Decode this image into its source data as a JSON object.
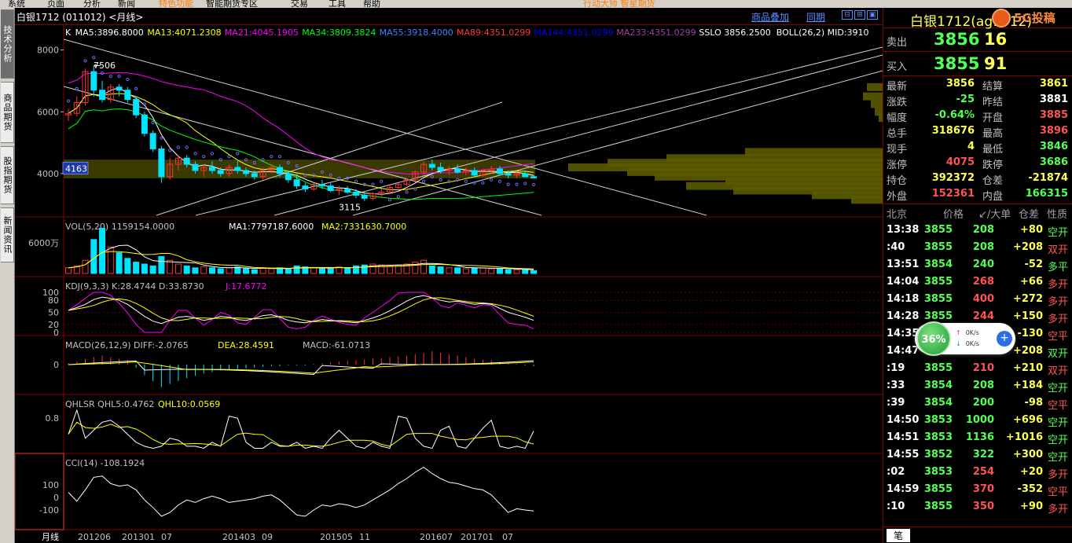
{
  "topbar": {
    "menu": [
      "系统",
      "页面",
      "分析",
      "新闻",
      "特色功能",
      "智能期货专区",
      "交易",
      "工具",
      "帮助"
    ],
    "center_text": "行动大师 智星期货"
  },
  "left_tabs": [
    {
      "label": "技术分析",
      "active": true
    },
    {
      "label": "商品期货",
      "active": false
    },
    {
      "label": "股指期货",
      "active": false
    },
    {
      "label": "新闻资讯",
      "active": false
    }
  ],
  "chart_header": {
    "title": "白银1712 (011012) <月线>",
    "btn_overlay": "商品叠加",
    "btn_sync": "同期"
  },
  "colors": {
    "up": "#ff3232",
    "down": "#00e5ff",
    "ma5": "#ffffff",
    "ma13": "#ffff00",
    "ma21": "#ff00ff",
    "ma34": "#00ff00",
    "ma55": "#3f7fff",
    "ma89": "#ff3838",
    "ma144": "#0000ff",
    "ma233": "#a040a0",
    "grid_red": "#800000"
  },
  "main_panel": {
    "legend": [
      {
        "text": "K",
        "color": "#ffffff"
      },
      {
        "text": "MA5:3896.8000",
        "color": "#ffffff"
      },
      {
        "text": "MA13:4071.2308",
        "color": "#ffff00"
      },
      {
        "text": "MA21:4045.1905",
        "color": "#ff00ff"
      },
      {
        "text": "MA34:3809.3824",
        "color": "#00ff00"
      },
      {
        "text": "MA55:3918.4000",
        "color": "#3f7fff"
      },
      {
        "text": "MA89:4351.0299",
        "color": "#ff3838"
      },
      {
        "text": "MA144:4351.0299",
        "color": "#0000ff"
      },
      {
        "text": "MA233:4351.0299",
        "color": "#a040a0"
      },
      {
        "text": "SSLO 3856.2500",
        "color": "#ffffff"
      },
      {
        "text": "BOLL(26,2) MID:3910",
        "color": "#ffffff"
      }
    ],
    "y_labels": [
      "8000",
      "6000",
      "4000"
    ],
    "price_tag": "4163",
    "high_label": "7506",
    "low_label": "3115"
  },
  "vol_panel": {
    "legend": "VOL(5,20) 1159154.0000",
    "ma1": "MA1:7797187.6000",
    "ma2": "MA2:7331630.7000",
    "y_label": "6000万"
  },
  "kdj_panel": {
    "legend": "KDJ(9,3,3) K:28.4744 D:33.8730",
    "j": "J:17.6772",
    "y_labels": [
      "100",
      "80",
      "50",
      "20",
      "0"
    ]
  },
  "macd_panel": {
    "legend": "MACD(26,12,9) DIFF:-2.0765",
    "dea": "DEA:28.4591",
    "macd": "MACD:-61.0713",
    "y_label": "0"
  },
  "qhlsr_panel": {
    "legend": "QHLSR QHL5:0.4762",
    "qhl10": "QHL10:0.0569",
    "y_label": "0.8"
  },
  "cci_panel": {
    "legend": "CCI(14) -108.1924",
    "y_labels": [
      "100",
      "0",
      "-100"
    ]
  },
  "x_axis": {
    "period": "月线",
    "labels": [
      "201206",
      "201301",
      "07",
      "201403",
      "09",
      "201505",
      "11",
      "201607",
      "201701",
      "07"
    ]
  },
  "quote": {
    "name": "白银1712(ag1712)",
    "logo_text": "5G投稿",
    "sell_label": "卖出",
    "sell_price": "3856",
    "sell_vol": "16",
    "buy_label": "买入",
    "buy_price": "3855",
    "buy_vol": "91",
    "stats": [
      {
        "l1": "最新",
        "v1": "3856",
        "c1": "#ffff54",
        "l2": "结算",
        "v2": "3861",
        "c2": "#ffff54"
      },
      {
        "l1": "涨跌",
        "v1": "-25",
        "c1": "#54ff54",
        "l2": "昨结",
        "v2": "3881",
        "c2": "#ffffff"
      },
      {
        "l1": "幅度",
        "v1": "-0.64%",
        "c1": "#54ff54",
        "l2": "开盘",
        "v2": "3885",
        "c2": "#ff5454"
      },
      {
        "l1": "总手",
        "v1": "318676",
        "c1": "#ffff54",
        "l2": "最高",
        "v2": "3896",
        "c2": "#ff5454"
      },
      {
        "l1": "现手",
        "v1": "4",
        "c1": "#ffff54",
        "l2": "最低",
        "v2": "3846",
        "c2": "#54ff54"
      },
      {
        "l1": "涨停",
        "v1": "4075",
        "c1": "#ff5454",
        "l2": "跌停",
        "v2": "3686",
        "c2": "#54ff54"
      },
      {
        "l1": "持仓",
        "v1": "392372",
        "c1": "#ffff54",
        "l2": "仓差",
        "v2": "-21874",
        "c2": "#ffff54"
      },
      {
        "l1": "外盘",
        "v1": "152361",
        "c1": "#ff5454",
        "l2": "内盘",
        "v2": "166315",
        "c2": "#54ff54"
      }
    ],
    "tick_head": {
      "time": "北京",
      "price": "价格",
      "vol": "↙/大单",
      "oi": "仓差",
      "nature": "性质"
    },
    "ticks": [
      {
        "time": "13:38",
        "price": "3855",
        "vol": "208",
        "vc": "#54ff54",
        "oi": "+80",
        "oc": "#ffff54",
        "nature": "空开",
        "nc": "#54ff54"
      },
      {
        "time": ":40",
        "price": "3855",
        "vol": "208",
        "vc": "#54ff54",
        "oi": "+208",
        "oc": "#ffff54",
        "nature": "双开",
        "nc": "#ff5454"
      },
      {
        "time": "13:51",
        "price": "3854",
        "vol": "240",
        "vc": "#54ff54",
        "oi": "-52",
        "oc": "#ffff54",
        "nature": "多平",
        "nc": "#54ff54"
      },
      {
        "time": "14:04",
        "price": "3855",
        "vol": "268",
        "vc": "#ff5454",
        "oi": "+66",
        "oc": "#ffff54",
        "nature": "多开",
        "nc": "#ff5454"
      },
      {
        "time": "14:18",
        "price": "3855",
        "vol": "400",
        "vc": "#ff5454",
        "oi": "+272",
        "oc": "#ffff54",
        "nature": "多开",
        "nc": "#ff5454"
      },
      {
        "time": "14:28",
        "price": "3855",
        "vol": "244",
        "vc": "#ff5454",
        "oi": "+150",
        "oc": "#ffff54",
        "nature": "多开",
        "nc": "#ff5454"
      },
      {
        "time": "14:35",
        "price": "3855",
        "vol": "244",
        "vc": "#ff5454",
        "oi": "-130",
        "oc": "#ffff54",
        "nature": "空平",
        "nc": "#ff5454"
      },
      {
        "time": "14:47",
        "price": "3855",
        "vol": "208",
        "vc": "#54ff54",
        "oi": "+208",
        "oc": "#ffff54",
        "nature": "双开",
        "nc": "#54ff54"
      },
      {
        "time": ":19",
        "price": "3855",
        "vol": "210",
        "vc": "#ff5454",
        "oi": "+210",
        "oc": "#ffff54",
        "nature": "双开",
        "nc": "#ff5454"
      },
      {
        "time": ":33",
        "price": "3854",
        "vol": "208",
        "vc": "#54ff54",
        "oi": "+184",
        "oc": "#ffff54",
        "nature": "空开",
        "nc": "#54ff54"
      },
      {
        "time": ":39",
        "price": "3854",
        "vol": "200",
        "vc": "#54ff54",
        "oi": "-98",
        "oc": "#ffff54",
        "nature": "空平",
        "nc": "#ff5454"
      },
      {
        "time": "14:50",
        "price": "3853",
        "vol": "1000",
        "vc": "#54ff54",
        "oi": "+696",
        "oc": "#ffff54",
        "nature": "空开",
        "nc": "#54ff54"
      },
      {
        "time": "14:51",
        "price": "3853",
        "vol": "1136",
        "vc": "#54ff54",
        "oi": "+1016",
        "oc": "#ffff54",
        "nature": "空开",
        "nc": "#54ff54"
      },
      {
        "time": "14:55",
        "price": "3852",
        "vol": "322",
        "vc": "#54ff54",
        "oi": "+300",
        "oc": "#ffff54",
        "nature": "空开",
        "nc": "#54ff54"
      },
      {
        "time": ":02",
        "price": "3853",
        "vol": "254",
        "vc": "#ff5454",
        "oi": "+20",
        "oc": "#ffff54",
        "nature": "多开",
        "nc": "#ff5454"
      },
      {
        "time": "14:59",
        "price": "3855",
        "vol": "370",
        "vc": "#ff5454",
        "oi": "-352",
        "oc": "#ffff54",
        "nature": "空平",
        "nc": "#ff5454"
      },
      {
        "time": ":10",
        "price": "3855",
        "vol": "350",
        "vc": "#ff5454",
        "oi": "+90",
        "oc": "#ffff54",
        "nature": "多开",
        "nc": "#ff5454"
      }
    ],
    "foot_tab": "笔"
  },
  "speed_widget": {
    "percent": "36%",
    "up": "0K/s",
    "down": "0K/s"
  },
  "chart_data": {
    "type": "candlestick",
    "period": "monthly",
    "ylim": [
      2700,
      8500
    ],
    "candles": [
      [
        5900,
        6100,
        5700,
        5950
      ],
      [
        5950,
        6500,
        5850,
        6300
      ],
      [
        6300,
        7400,
        6200,
        7300
      ],
      [
        7300,
        7506,
        6500,
        6700
      ],
      [
        6700,
        7000,
        6300,
        6400
      ],
      [
        6400,
        6900,
        6300,
        6800
      ],
      [
        6800,
        6900,
        6500,
        6700
      ],
      [
        6700,
        6800,
        6300,
        6400
      ],
      [
        6400,
        6500,
        5800,
        5900
      ],
      [
        5900,
        6000,
        5200,
        5300
      ],
      [
        5300,
        5400,
        4700,
        4800
      ],
      [
        4800,
        4900,
        3700,
        3900
      ],
      [
        3900,
        4500,
        3800,
        4300
      ],
      [
        4300,
        4600,
        4100,
        4500
      ],
      [
        4500,
        4600,
        4200,
        4300
      ],
      [
        4300,
        4400,
        4000,
        4100
      ],
      [
        4100,
        4300,
        3900,
        4200
      ],
      [
        4200,
        4400,
        4000,
        4100
      ],
      [
        4100,
        4200,
        3900,
        4000
      ],
      [
        4000,
        4300,
        3900,
        4200
      ],
      [
        4200,
        4400,
        4000,
        4100
      ],
      [
        4100,
        4200,
        3900,
        4000
      ],
      [
        4000,
        4100,
        3800,
        3900
      ],
      [
        3900,
        4200,
        3800,
        4100
      ],
      [
        4100,
        4300,
        4000,
        4200
      ],
      [
        4200,
        4300,
        3900,
        4000
      ],
      [
        4000,
        4100,
        3700,
        3800
      ],
      [
        3800,
        4000,
        3500,
        3600
      ],
      [
        3600,
        3700,
        3400,
        3500
      ],
      [
        3500,
        3700,
        3450,
        3650
      ],
      [
        3650,
        3800,
        3500,
        3600
      ],
      [
        3600,
        3700,
        3400,
        3450
      ],
      [
        3450,
        3600,
        3300,
        3500
      ],
      [
        3500,
        3600,
        3350,
        3400
      ],
      [
        3400,
        3500,
        3200,
        3300
      ],
      [
        3300,
        3400,
        3115,
        3200
      ],
      [
        3200,
        3400,
        3150,
        3350
      ],
      [
        3350,
        3500,
        3250,
        3400
      ],
      [
        3400,
        3600,
        3350,
        3550
      ],
      [
        3550,
        3700,
        3450,
        3650
      ],
      [
        3650,
        3850,
        3600,
        3800
      ],
      [
        3800,
        4100,
        3700,
        4050
      ],
      [
        4050,
        4400,
        3950,
        4300
      ],
      [
        4300,
        4450,
        4100,
        4200
      ],
      [
        4200,
        4350,
        4000,
        4100
      ],
      [
        4100,
        4250,
        3950,
        4150
      ],
      [
        4150,
        4300,
        4000,
        4050
      ],
      [
        4050,
        4200,
        3950,
        4100
      ],
      [
        4100,
        4200,
        3900,
        3950
      ],
      [
        3950,
        4150,
        3900,
        4100
      ],
      [
        4100,
        4250,
        4000,
        4150
      ],
      [
        4150,
        4250,
        3950,
        4000
      ],
      [
        4000,
        4100,
        3850,
        3950
      ],
      [
        3950,
        4050,
        3850,
        4000
      ],
      [
        4000,
        4100,
        3880,
        3900
      ],
      [
        3900,
        3950,
        3840,
        3860
      ]
    ],
    "x_labels": [
      "201206",
      "201301",
      "07",
      "201403",
      "09",
      "201505",
      "11",
      "201607",
      "201701",
      "07"
    ]
  }
}
